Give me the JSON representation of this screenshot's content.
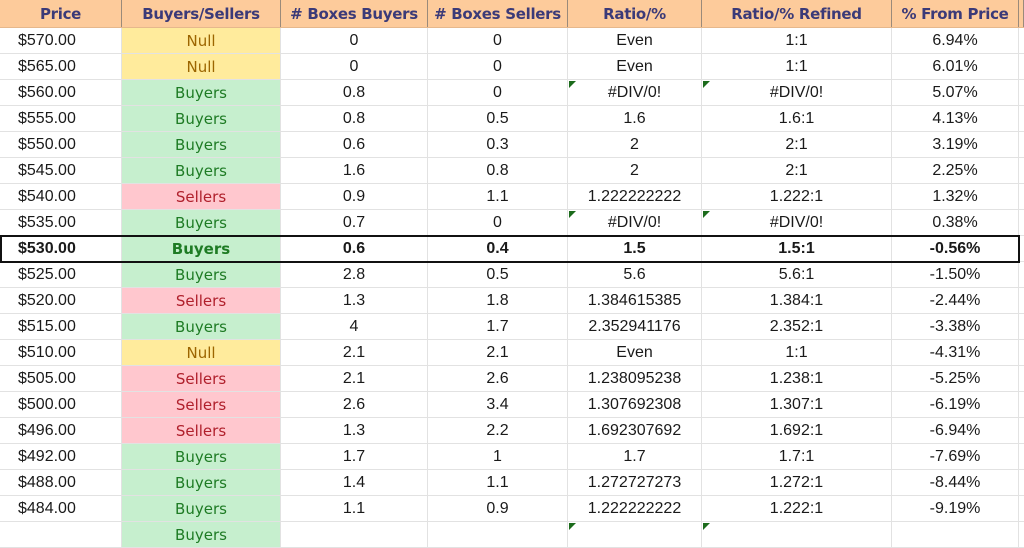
{
  "columns": [
    "Price",
    "Buyers/Sellers",
    "# Boxes Buyers",
    "# Boxes Sellers",
    "Ratio/%",
    "Ratio/% Refined",
    "% From Price"
  ],
  "colors": {
    "header_bg": "#fdcb9b",
    "header_text": "#3b3a78",
    "buyers_bg": "#c6efce",
    "buyers_text": "#1e7b24",
    "sellers_bg": "#ffc7ce",
    "sellers_text": "#b0202c",
    "null_bg": "#ffeb9c",
    "null_text": "#9c6500",
    "error_indicator": "#1b6b1b"
  },
  "current_price_row_index": 8,
  "rows": [
    {
      "price": "$570.00",
      "side": "Null",
      "boxes_buyers": "0",
      "boxes_sellers": "0",
      "ratio": "Even",
      "ratio_refined": "1:1",
      "pct_from_price": "6.94%",
      "error_flag": false
    },
    {
      "price": "$565.00",
      "side": "Null",
      "boxes_buyers": "0",
      "boxes_sellers": "0",
      "ratio": "Even",
      "ratio_refined": "1:1",
      "pct_from_price": "6.01%",
      "error_flag": false
    },
    {
      "price": "$560.00",
      "side": "Buyers",
      "boxes_buyers": "0.8",
      "boxes_sellers": "0",
      "ratio": "#DIV/0!",
      "ratio_refined": "#DIV/0!",
      "pct_from_price": "5.07%",
      "error_flag": true
    },
    {
      "price": "$555.00",
      "side": "Buyers",
      "boxes_buyers": "0.8",
      "boxes_sellers": "0.5",
      "ratio": "1.6",
      "ratio_refined": "1.6:1",
      "pct_from_price": "4.13%",
      "error_flag": false
    },
    {
      "price": "$550.00",
      "side": "Buyers",
      "boxes_buyers": "0.6",
      "boxes_sellers": "0.3",
      "ratio": "2",
      "ratio_refined": "2:1",
      "pct_from_price": "3.19%",
      "error_flag": false
    },
    {
      "price": "$545.00",
      "side": "Buyers",
      "boxes_buyers": "1.6",
      "boxes_sellers": "0.8",
      "ratio": "2",
      "ratio_refined": "2:1",
      "pct_from_price": "2.25%",
      "error_flag": false
    },
    {
      "price": "$540.00",
      "side": "Sellers",
      "boxes_buyers": "0.9",
      "boxes_sellers": "1.1",
      "ratio": "1.222222222",
      "ratio_refined": "1.222:1",
      "pct_from_price": "1.32%",
      "error_flag": false
    },
    {
      "price": "$535.00",
      "side": "Buyers",
      "boxes_buyers": "0.7",
      "boxes_sellers": "0",
      "ratio": "#DIV/0!",
      "ratio_refined": "#DIV/0!",
      "pct_from_price": "0.38%",
      "error_flag": true
    },
    {
      "price": "$530.00",
      "side": "Buyers",
      "boxes_buyers": "0.6",
      "boxes_sellers": "0.4",
      "ratio": "1.5",
      "ratio_refined": "1.5:1",
      "pct_from_price": "-0.56%",
      "error_flag": false
    },
    {
      "price": "$525.00",
      "side": "Buyers",
      "boxes_buyers": "2.8",
      "boxes_sellers": "0.5",
      "ratio": "5.6",
      "ratio_refined": "5.6:1",
      "pct_from_price": "-1.50%",
      "error_flag": false
    },
    {
      "price": "$520.00",
      "side": "Sellers",
      "boxes_buyers": "1.3",
      "boxes_sellers": "1.8",
      "ratio": "1.384615385",
      "ratio_refined": "1.384:1",
      "pct_from_price": "-2.44%",
      "error_flag": false
    },
    {
      "price": "$515.00",
      "side": "Buyers",
      "boxes_buyers": "4",
      "boxes_sellers": "1.7",
      "ratio": "2.352941176",
      "ratio_refined": "2.352:1",
      "pct_from_price": "-3.38%",
      "error_flag": false
    },
    {
      "price": "$510.00",
      "side": "Null",
      "boxes_buyers": "2.1",
      "boxes_sellers": "2.1",
      "ratio": "Even",
      "ratio_refined": "1:1",
      "pct_from_price": "-4.31%",
      "error_flag": false
    },
    {
      "price": "$505.00",
      "side": "Sellers",
      "boxes_buyers": "2.1",
      "boxes_sellers": "2.6",
      "ratio": "1.238095238",
      "ratio_refined": "1.238:1",
      "pct_from_price": "-5.25%",
      "error_flag": false
    },
    {
      "price": "$500.00",
      "side": "Sellers",
      "boxes_buyers": "2.6",
      "boxes_sellers": "3.4",
      "ratio": "1.307692308",
      "ratio_refined": "1.307:1",
      "pct_from_price": "-6.19%",
      "error_flag": false
    },
    {
      "price": "$496.00",
      "side": "Sellers",
      "boxes_buyers": "1.3",
      "boxes_sellers": "2.2",
      "ratio": "1.692307692",
      "ratio_refined": "1.692:1",
      "pct_from_price": "-6.94%",
      "error_flag": false
    },
    {
      "price": "$492.00",
      "side": "Buyers",
      "boxes_buyers": "1.7",
      "boxes_sellers": "1",
      "ratio": "1.7",
      "ratio_refined": "1.7:1",
      "pct_from_price": "-7.69%",
      "error_flag": false
    },
    {
      "price": "$488.00",
      "side": "Buyers",
      "boxes_buyers": "1.4",
      "boxes_sellers": "1.1",
      "ratio": "1.272727273",
      "ratio_refined": "1.272:1",
      "pct_from_price": "-8.44%",
      "error_flag": false
    },
    {
      "price": "$484.00",
      "side": "Buyers",
      "boxes_buyers": "1.1",
      "boxes_sellers": "0.9",
      "ratio": "1.222222222",
      "ratio_refined": "1.222:1",
      "pct_from_price": "-9.19%",
      "error_flag": false
    },
    {
      "price": "",
      "side": "Buyers",
      "boxes_buyers": "",
      "boxes_sellers": "",
      "ratio": "",
      "ratio_refined": "",
      "pct_from_price": "",
      "error_flag": true
    }
  ]
}
